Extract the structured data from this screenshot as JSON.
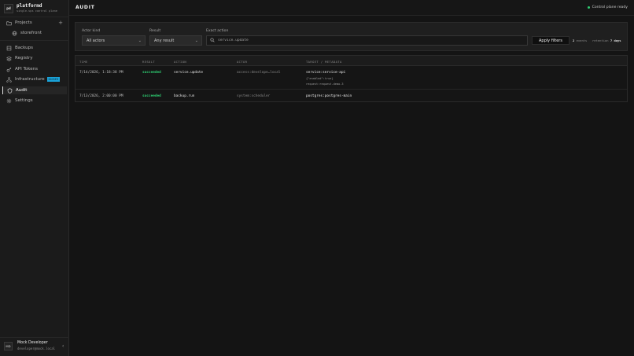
{
  "brand": {
    "logo": "pd",
    "name": "platformd",
    "subtitle": "single-vps control plane"
  },
  "sidebar": {
    "projects_label": "Projects",
    "project_child": "storefront",
    "items": [
      {
        "label": "Backups",
        "icon": "database-icon"
      },
      {
        "label": "Registry",
        "icon": "layers-icon"
      },
      {
        "label": "API Tokens",
        "icon": "key-icon"
      },
      {
        "label": "Infrastructure",
        "icon": "network-icon",
        "badge": "DOCKER"
      },
      {
        "label": "Audit",
        "icon": "shield-icon",
        "active": true
      },
      {
        "label": "Settings",
        "icon": "gear-icon"
      }
    ]
  },
  "user": {
    "initials": "MD",
    "name": "Mock Developer",
    "email": "developer@mock.local"
  },
  "header": {
    "title": "AUDIT",
    "status": "Control plane ready",
    "status_color": "#2ecc71"
  },
  "filters": {
    "actor_kind_label": "Actor kind",
    "actor_kind_value": "All actors",
    "result_label": "Result",
    "result_value": "Any result",
    "exact_action_label": "Exact action",
    "exact_action_value": "service.update",
    "apply_label": "Apply filters",
    "events_count": "2",
    "events_label": "events",
    "retention_label": "retention",
    "retention_value": "7 days"
  },
  "table": {
    "headers": [
      "TIME",
      "RESULT",
      "ACTION",
      "ACTOR",
      "TARGET / METADATA"
    ],
    "rows": [
      {
        "time": "7/14/2026, 1:18:38 PM",
        "result": "succeeded",
        "action": "service.update",
        "actor": "access:develope…local",
        "target": "service:service-api",
        "meta1": "{\"enabled\":true}",
        "meta2": "request:request-demo-3"
      },
      {
        "time": "7/13/2026, 2:00:00 PM",
        "result": "succeeded",
        "action": "backup.run",
        "actor": "system:scheduler",
        "target": "postgres:postgres-main"
      }
    ]
  }
}
